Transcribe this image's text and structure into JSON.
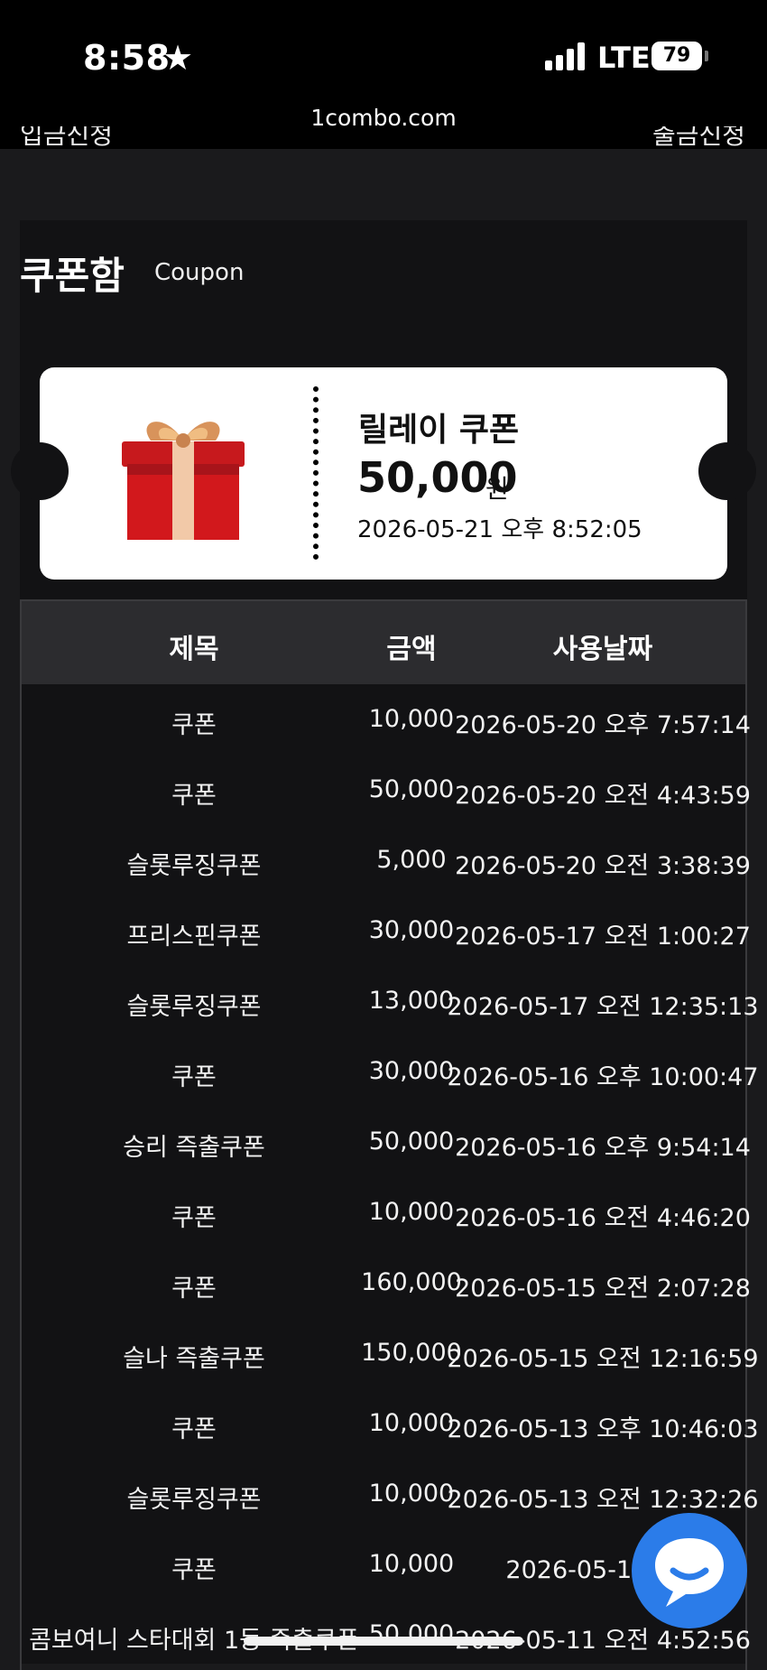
{
  "status_bar": {
    "time": "8:58",
    "network": "LTE",
    "battery": "79"
  },
  "browser": {
    "url": "1combo.com"
  },
  "top_links": {
    "deposit": "입금신청",
    "withdraw": "출금신청"
  },
  "page": {
    "title": "쿠폰함",
    "subtitle": "Coupon"
  },
  "featured_coupon": {
    "name": "릴레이 쿠폰",
    "amount": "50,000",
    "unit": "원",
    "date": "2026-05-21 오후 8:52:05"
  },
  "table": {
    "headers": [
      "제목",
      "금액",
      "사용날짜"
    ],
    "rows": [
      {
        "title": "쿠폰",
        "amount": "10,000",
        "date": "2026-05-20 오후 7:57:14"
      },
      {
        "title": "쿠폰",
        "amount": "50,000",
        "date": "2026-05-20 오전 4:43:59"
      },
      {
        "title": "슬롯루징쿠폰",
        "amount": "5,000",
        "date": "2026-05-20 오전 3:38:39"
      },
      {
        "title": "프리스핀쿠폰",
        "amount": "30,000",
        "date": "2026-05-17 오전 1:00:27"
      },
      {
        "title": "슬롯루징쿠폰",
        "amount": "13,000",
        "date": "2026-05-17 오전 12:35:13"
      },
      {
        "title": "쿠폰",
        "amount": "30,000",
        "date": "2026-05-16 오후 10:00:47"
      },
      {
        "title": "승리 즉출쿠폰",
        "amount": "50,000",
        "date": "2026-05-16 오후 9:54:14"
      },
      {
        "title": "쿠폰",
        "amount": "10,000",
        "date": "2026-05-16 오전 4:46:20"
      },
      {
        "title": "쿠폰",
        "amount": "160,000",
        "date": "2026-05-15 오전 2:07:28"
      },
      {
        "title": "슬나 즉출쿠폰",
        "amount": "150,000",
        "date": "2026-05-15 오전 12:16:59"
      },
      {
        "title": "쿠폰",
        "amount": "10,000",
        "date": "2026-05-13 오후 10:46:03"
      },
      {
        "title": "슬롯루징쿠폰",
        "amount": "10,000",
        "date": "2026-05-13 오전 12:32:26"
      },
      {
        "title": "쿠폰",
        "amount": "10,000",
        "date": "2026-05-12 오후"
      },
      {
        "title": "콤보여니 스타대회 1등 즉출쿠폰",
        "amount": "50,000",
        "date": "2026-05-11 오전 4:52:56"
      }
    ]
  }
}
